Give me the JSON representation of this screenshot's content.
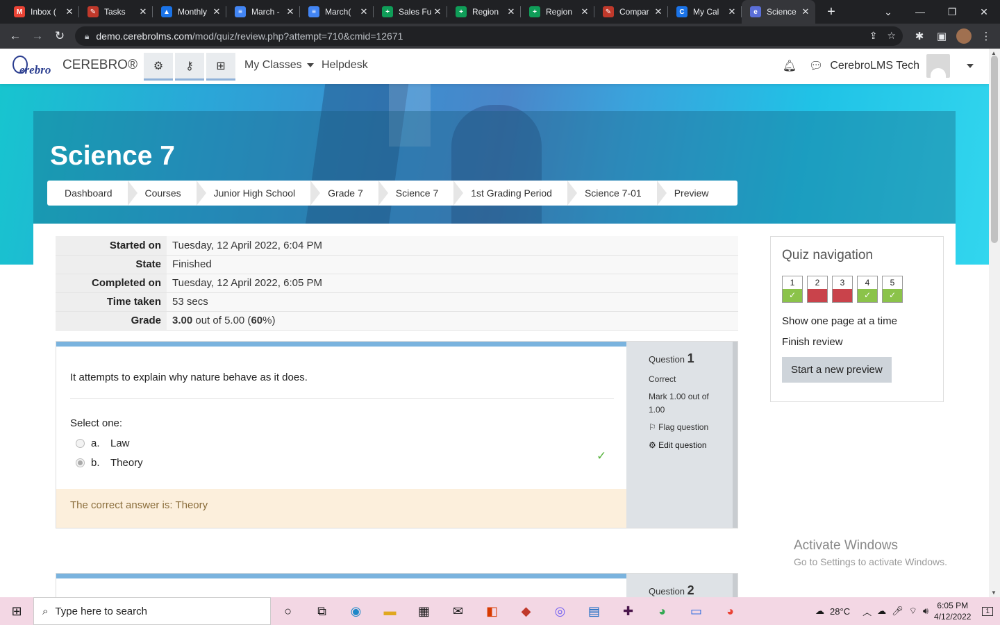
{
  "browser": {
    "tabs": [
      {
        "label": "Inbox (",
        "color": "#ea4335",
        "glyph": "M"
      },
      {
        "label": "Tasks",
        "color": "#c0392b",
        "glyph": "✎"
      },
      {
        "label": "Monthly",
        "color": "#1a73e8",
        "glyph": "▲"
      },
      {
        "label": "March -",
        "color": "#4285f4",
        "glyph": "≡"
      },
      {
        "label": "March(",
        "color": "#4285f4",
        "glyph": "≡"
      },
      {
        "label": "Sales Fu",
        "color": "#0f9d58",
        "glyph": "+"
      },
      {
        "label": "Region",
        "color": "#0f9d58",
        "glyph": "+"
      },
      {
        "label": "Region",
        "color": "#0f9d58",
        "glyph": "+"
      },
      {
        "label": "Compar",
        "color": "#c0392b",
        "glyph": "✎"
      },
      {
        "label": "My Cal",
        "color": "#1a73e8",
        "glyph": "C"
      },
      {
        "label": "Science",
        "color": "#5b6fd8",
        "glyph": "e",
        "active": true
      }
    ],
    "url_domain": "demo.cerebrolms.com",
    "url_path": "/mod/quiz/review.php?attempt=710&cmid=12671"
  },
  "site": {
    "brand": "CEREBRO®",
    "logo_text": "erebro",
    "menu_my_classes": "My Classes",
    "menu_helpdesk": "Helpdesk",
    "user_name": "CerebroLMS Tech"
  },
  "course": {
    "title": "Science 7",
    "breadcrumbs": [
      "Dashboard",
      "Courses",
      "Junior High School",
      "Grade 7",
      "Science 7",
      "1st Grading Period",
      "Science 7-01",
      "Preview"
    ]
  },
  "summary": {
    "rows": [
      {
        "label": "Started on",
        "value": "Tuesday, 12 April 2022, 6:04 PM"
      },
      {
        "label": "State",
        "value": "Finished"
      },
      {
        "label": "Completed on",
        "value": "Tuesday, 12 April 2022, 6:05 PM"
      },
      {
        "label": "Time taken",
        "value": "53 secs"
      }
    ],
    "grade_label": "Grade",
    "grade_score": "3.00",
    "grade_outof": " out of 5.00 (",
    "grade_pct": "60",
    "grade_tail": "%)"
  },
  "question1": {
    "label": "Question",
    "number": "1",
    "status": "Correct",
    "mark": "Mark 1.00 out of 1.00",
    "flag": "Flag question",
    "edit": "Edit question",
    "text": "It attempts to explain why nature behave as it does.",
    "select": "Select one:",
    "options": [
      {
        "letter": "a.",
        "text": "Law",
        "selected": false
      },
      {
        "letter": "b.",
        "text": "Theory",
        "selected": true
      }
    ],
    "feedback": "The correct answer is: Theory"
  },
  "question2": {
    "label": "Question",
    "number": "2"
  },
  "quiz_nav": {
    "title": "Quiz navigation",
    "buttons": [
      {
        "n": "1",
        "state": "ok"
      },
      {
        "n": "2",
        "state": "bad"
      },
      {
        "n": "3",
        "state": "bad"
      },
      {
        "n": "4",
        "state": "ok"
      },
      {
        "n": "5",
        "state": "ok"
      }
    ],
    "one_page": "Show one page at a time",
    "finish": "Finish review",
    "new_preview": "Start a new preview"
  },
  "watermark": {
    "line1": "Activate Windows",
    "line2": "Go to Settings to activate Windows."
  },
  "taskbar": {
    "search_placeholder": "Type here to search",
    "weather": "28°C",
    "time": "6:05 PM",
    "date": "4/12/2022",
    "notifications": "1"
  }
}
